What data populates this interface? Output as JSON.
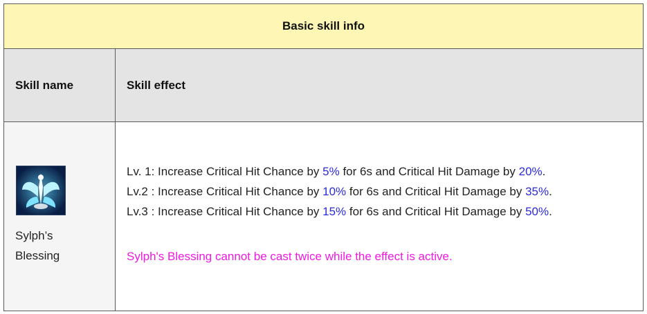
{
  "table": {
    "title": "Basic skill info",
    "headers": {
      "skill_name": "Skill name",
      "skill_effect": "Skill effect"
    },
    "colors": {
      "title_bg": "#fdf6b4",
      "header_bg": "#e4e4e4",
      "value": "#2b2bd9",
      "note": "#f019e0"
    },
    "skill": {
      "icon": "sylphs-blessing-icon",
      "name_line1": "Sylph’s",
      "name_line2": "Blessing"
    },
    "levels": [
      {
        "prefix": "Lv. 1: Increase Critical Hit Chance by ",
        "chance": "5%",
        "mid": " for 6s and Critical Hit Damage by ",
        "damage": "20%",
        "end": "."
      },
      {
        "prefix": "Lv.2 : Increase Critical Hit Chance by ",
        "chance": "10%",
        "mid": " for 6s and Critical Hit Damage by ",
        "damage": "35%",
        "end": "."
      },
      {
        "prefix": "Lv.3 : Increase Critical Hit Chance by ",
        "chance": "15%",
        "mid": " for 6s and Critical Hit Damage by ",
        "damage": "50%",
        "end": "."
      }
    ],
    "note": "Sylph's Blessing cannot be cast twice while the effect is active."
  }
}
